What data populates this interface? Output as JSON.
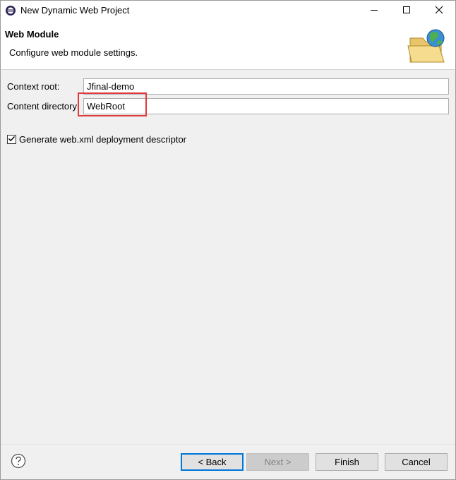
{
  "window": {
    "title": "New Dynamic Web Project",
    "icon": "eclipse-icon"
  },
  "title_controls": {
    "minimize": "minimize-icon",
    "maximize": "maximize-icon",
    "close": "close-icon"
  },
  "banner": {
    "title": "Web Module",
    "description": "Configure web module settings.",
    "icon": "folder-globe-icon"
  },
  "form": {
    "context_root": {
      "label": "Context root:",
      "value": "Jfinal-demo"
    },
    "content_directory": {
      "label": "Content directory:",
      "value": "WebRoot"
    },
    "generate_descriptor": {
      "label": "Generate web.xml deployment descriptor",
      "checked": true
    }
  },
  "footer": {
    "help_icon": "help-icon",
    "back_label": "< Back",
    "next_label": "Next >",
    "finish_label": "Finish",
    "cancel_label": "Cancel"
  },
  "colors": {
    "highlight": "#e03a3a",
    "default_button_border": "#0078d7"
  }
}
